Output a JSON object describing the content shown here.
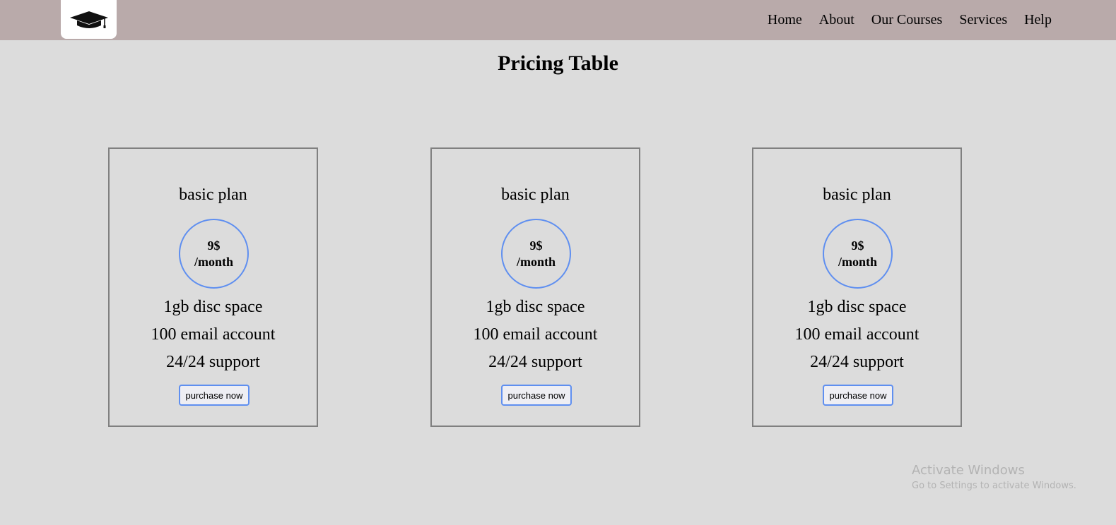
{
  "header": {
    "logo_icon": "graduation-cap-icon",
    "nav": [
      {
        "label": "Home"
      },
      {
        "label": "About"
      },
      {
        "label": "Our Courses"
      },
      {
        "label": "Services"
      },
      {
        "label": "Help"
      }
    ]
  },
  "main": {
    "title": "Pricing Table",
    "plans": [
      {
        "name": "basic plan",
        "price": "9$",
        "period": "/month",
        "features": [
          "1gb disc space",
          "100 email account",
          "24/24 support"
        ],
        "button_label": "purchase now"
      },
      {
        "name": "basic plan",
        "price": "9$",
        "period": "/month",
        "features": [
          "1gb disc space",
          "100 email account",
          "24/24 support"
        ],
        "button_label": "purchase now"
      },
      {
        "name": "basic plan",
        "price": "9$",
        "period": "/month",
        "features": [
          "1gb disc space",
          "100 email account",
          "24/24 support"
        ],
        "button_label": "purchase now"
      }
    ]
  },
  "watermark": {
    "title": "Activate Windows",
    "subtitle": "Go to Settings to activate Windows."
  },
  "colors": {
    "navbar_bg": "#b9aaaa",
    "page_bg": "#dcdcdc",
    "accent_blue": "#5f8ff0",
    "card_border": "#808080"
  }
}
